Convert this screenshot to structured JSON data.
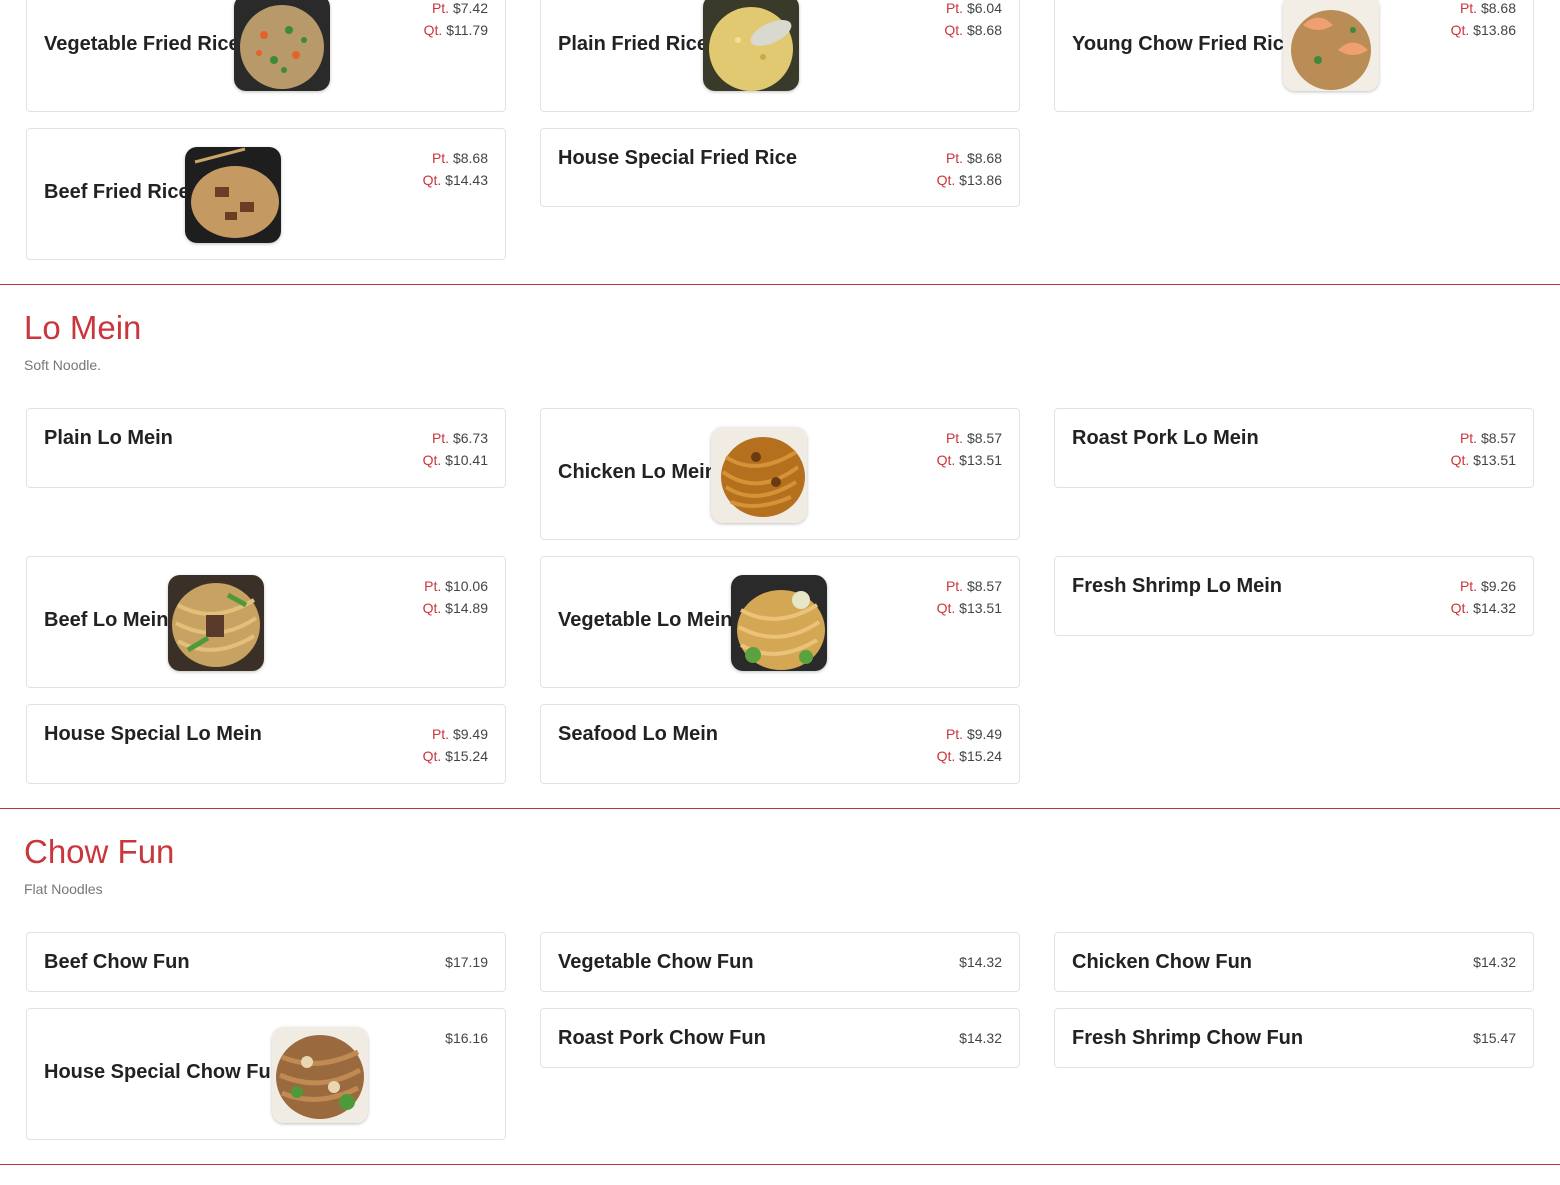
{
  "colors": {
    "accent": "#c9363c",
    "divider": "#b23a35",
    "card_border": "#e2e2e2"
  },
  "labels": {
    "pint": "Pt.",
    "quart": "Qt."
  },
  "fried_rice": {
    "items": [
      {
        "name": "Vegetable Fried Rice",
        "pt": "$7.42",
        "qt": "$11.79",
        "image": "vegetable-fried-rice-photo"
      },
      {
        "name": "Plain Fried Rice",
        "pt": "$6.04",
        "qt": "$8.68",
        "image": "plain-fried-rice-photo"
      },
      {
        "name": "Young Chow Fried Rice",
        "pt": "$8.68",
        "qt": "$13.86",
        "image": "young-chow-fried-rice-photo"
      },
      {
        "name": "Beef Fried Rice",
        "pt": "$8.68",
        "qt": "$14.43",
        "image": "beef-fried-rice-photo"
      },
      {
        "name": "House Special Fried Rice",
        "pt": "$8.68",
        "qt": "$13.86"
      }
    ]
  },
  "lo_mein": {
    "title": "Lo Mein",
    "subtitle": "Soft Noodle.",
    "items": [
      {
        "name": "Plain Lo Mein",
        "pt": "$6.73",
        "qt": "$10.41"
      },
      {
        "name": "Chicken Lo Mein",
        "pt": "$8.57",
        "qt": "$13.51",
        "image": "chicken-lo-mein-photo"
      },
      {
        "name": "Roast Pork Lo Mein",
        "pt": "$8.57",
        "qt": "$13.51"
      },
      {
        "name": "Beef Lo Mein",
        "pt": "$10.06",
        "qt": "$14.89",
        "image": "beef-lo-mein-photo"
      },
      {
        "name": "Vegetable Lo Mein",
        "pt": "$8.57",
        "qt": "$13.51",
        "image": "vegetable-lo-mein-photo"
      },
      {
        "name": "Fresh Shrimp Lo Mein",
        "pt": "$9.26",
        "qt": "$14.32"
      },
      {
        "name": "House Special Lo Mein",
        "pt": "$9.49",
        "qt": "$15.24"
      },
      {
        "name": "Seafood Lo Mein",
        "pt": "$9.49",
        "qt": "$15.24"
      }
    ]
  },
  "chow_fun": {
    "title": "Chow Fun",
    "subtitle": "Flat Noodles",
    "items": [
      {
        "name": "Beef Chow Fun",
        "price": "$17.19"
      },
      {
        "name": "Vegetable Chow Fun",
        "price": "$14.32"
      },
      {
        "name": "Chicken Chow Fun",
        "price": "$14.32"
      },
      {
        "name": "House Special Chow Fun",
        "price": "$16.16",
        "image": "house-special-chow-fun-photo"
      },
      {
        "name": "Roast Pork Chow Fun",
        "price": "$14.32"
      },
      {
        "name": "Fresh Shrimp Chow Fun",
        "price": "$15.47"
      }
    ]
  }
}
